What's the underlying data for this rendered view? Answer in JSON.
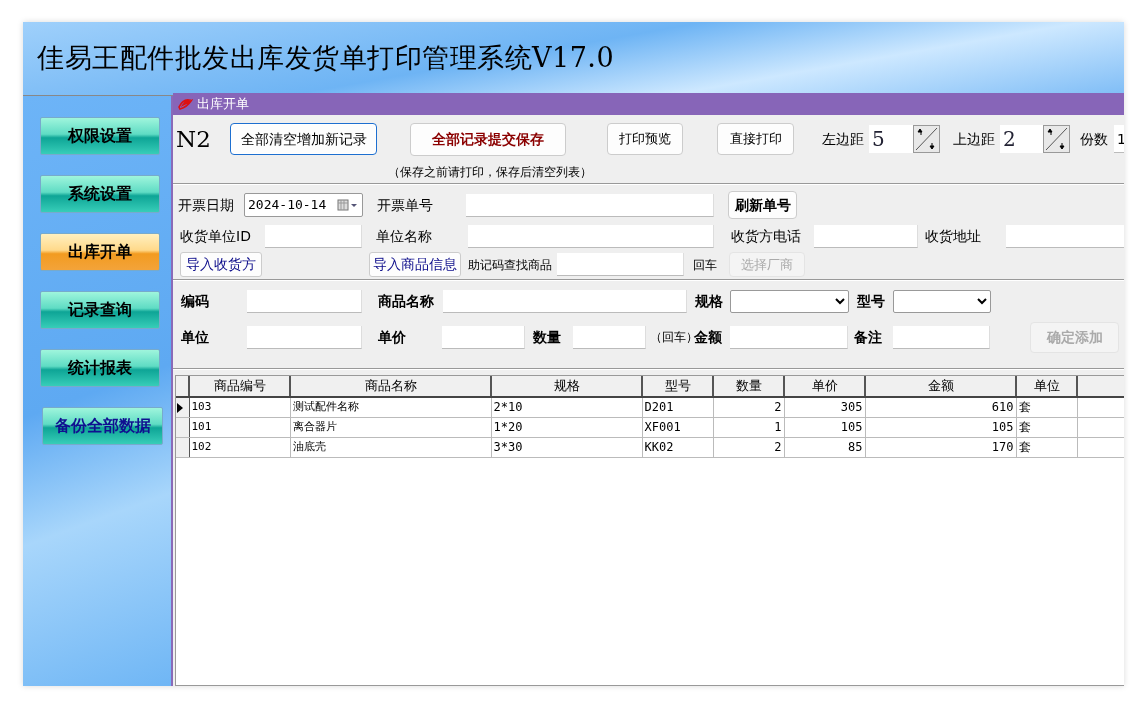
{
  "window": {
    "title": "佳易王配件批发出库发货单打印管理系统V17.0"
  },
  "sidebar": {
    "items": [
      {
        "label": "权限设置",
        "selected": false,
        "kind": "nav"
      },
      {
        "label": "系统设置",
        "selected": false,
        "kind": "nav"
      },
      {
        "label": "出库开单",
        "selected": true,
        "kind": "nav"
      },
      {
        "label": "记录查询",
        "selected": false,
        "kind": "nav"
      },
      {
        "label": "统计报表",
        "selected": false,
        "kind": "nav"
      },
      {
        "label": "备份全部数据",
        "selected": false,
        "kind": "action"
      }
    ]
  },
  "panel": {
    "title": "出库开单"
  },
  "toolbar": {
    "items": [
      {
        "kind": "big-label",
        "text": "N2"
      },
      {
        "kind": "button",
        "text": "全部清空增加新记录",
        "bold": false,
        "disabled": false
      },
      {
        "kind": "primary-button",
        "text": "全部记录提交保存",
        "bold": true,
        "disabled": false
      },
      {
        "kind": "button",
        "text": "打印预览",
        "bold": false,
        "disabled": false
      },
      {
        "kind": "button",
        "text": "直接打印",
        "bold": false,
        "disabled": false
      },
      {
        "kind": "label",
        "text": "左边距",
        "bold": false
      },
      {
        "kind": "spinner",
        "value": "5"
      },
      {
        "kind": "label",
        "text": "上边距",
        "bold": false
      },
      {
        "kind": "spinner",
        "value": "2"
      },
      {
        "kind": "label",
        "text": "份数",
        "bold": false
      },
      {
        "kind": "field",
        "value": "1"
      }
    ],
    "note": "（保存之前请打印，保存后清空列表）"
  },
  "invoice_rows": [
    [
      {
        "kind": "label",
        "text": "开票日期",
        "bold": false
      },
      {
        "kind": "date",
        "value": "2024-10-14"
      },
      {
        "kind": "label",
        "text": "开票单号",
        "bold": false
      },
      {
        "kind": "field"
      },
      {
        "kind": "button",
        "text": "刷新单号",
        "bold": true,
        "disabled": false
      }
    ],
    [
      {
        "kind": "label",
        "text": "收货单位ID",
        "bold": false
      },
      {
        "kind": "field"
      },
      {
        "kind": "label",
        "text": "单位名称",
        "bold": false
      },
      {
        "kind": "field"
      },
      {
        "kind": "label",
        "text": "收货方电话",
        "bold": false
      },
      {
        "kind": "field"
      },
      {
        "kind": "label",
        "text": "收货地址",
        "bold": false
      },
      {
        "kind": "field"
      }
    ],
    [
      {
        "kind": "import-button",
        "text": "导入收货方",
        "bold": false,
        "disabled": false
      },
      {
        "kind": "import-button",
        "text": "导入商品信息",
        "bold": false,
        "disabled": false
      },
      {
        "kind": "small-label",
        "text": "助记码查找商品",
        "bold": false
      },
      {
        "kind": "field"
      },
      {
        "kind": "small-label",
        "text": "回车",
        "bold": false
      },
      {
        "kind": "button",
        "text": "选择厂商",
        "bold": false,
        "disabled": true
      }
    ]
  ],
  "item_rows": [
    [
      {
        "kind": "label",
        "text": "编码",
        "bold": true
      },
      {
        "kind": "field"
      },
      {
        "kind": "label",
        "text": "商品名称",
        "bold": true
      },
      {
        "kind": "field"
      },
      {
        "kind": "label",
        "text": "规格",
        "bold": true
      },
      {
        "kind": "select"
      },
      {
        "kind": "label",
        "text": "型号",
        "bold": true
      },
      {
        "kind": "select"
      }
    ],
    [
      {
        "kind": "label",
        "text": "单位",
        "bold": true
      },
      {
        "kind": "field"
      },
      {
        "kind": "label",
        "text": "单价",
        "bold": true
      },
      {
        "kind": "field"
      },
      {
        "kind": "label",
        "text": "数量",
        "bold": true
      },
      {
        "kind": "field"
      },
      {
        "kind": "small-label",
        "text": "（回车）",
        "bold": false
      },
      {
        "kind": "label",
        "text": "金额",
        "bold": true
      },
      {
        "kind": "field"
      },
      {
        "kind": "label",
        "text": "备注",
        "bold": true
      },
      {
        "kind": "field"
      },
      {
        "kind": "button",
        "text": "确定添加",
        "bold": true,
        "disabled": true
      }
    ]
  ],
  "table": {
    "columns": [
      "商品编号",
      "商品名称",
      "规格",
      "型号",
      "数量",
      "单价",
      "金额",
      "单位"
    ],
    "rows": [
      {
        "selected": true,
        "cells": [
          "103",
          "测试配件名称",
          "2*10",
          "D201",
          "2",
          "305",
          "610",
          "套"
        ]
      },
      {
        "selected": false,
        "cells": [
          "101",
          "离合器片",
          "1*20",
          "XF001",
          "1",
          "105",
          "105",
          "套"
        ]
      },
      {
        "selected": false,
        "cells": [
          "102",
          "油底壳",
          "3*30",
          "KK02",
          "2",
          "85",
          "170",
          "套"
        ]
      }
    ]
  }
}
